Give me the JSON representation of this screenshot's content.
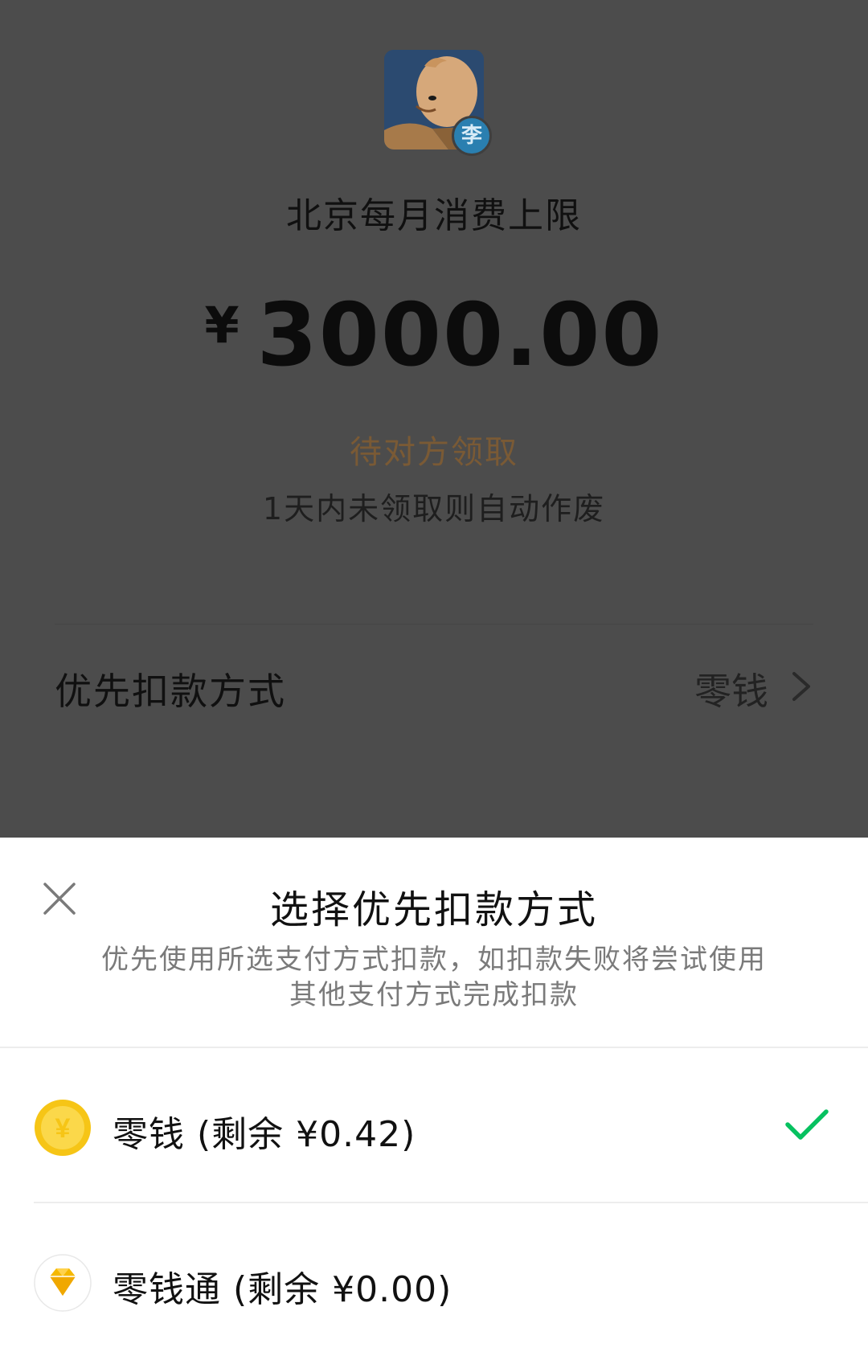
{
  "transfer": {
    "avatar_badge": "李",
    "title": "北京每月消费上限",
    "currency": "¥",
    "amount": "3000.00",
    "status": "待对方领取",
    "status_note": "1天内未领取则自动作废",
    "status_color": "#7a5a35"
  },
  "preferred_payment": {
    "label": "优先扣款方式",
    "value": "零钱"
  },
  "sheet": {
    "title": "选择优先扣款方式",
    "description": "优先使用所选支付方式扣款，如扣款失败将尝试使用其他支付方式完成扣款",
    "close_icon": "close-icon",
    "options": [
      {
        "label": "零钱 (剩余 ¥0.42)",
        "icon": "coin-yuan-icon",
        "selected": true
      },
      {
        "label": "零钱通 (剩余 ¥0.00)",
        "icon": "diamond-icon",
        "selected": false
      }
    ],
    "check_color": "#07c160"
  }
}
